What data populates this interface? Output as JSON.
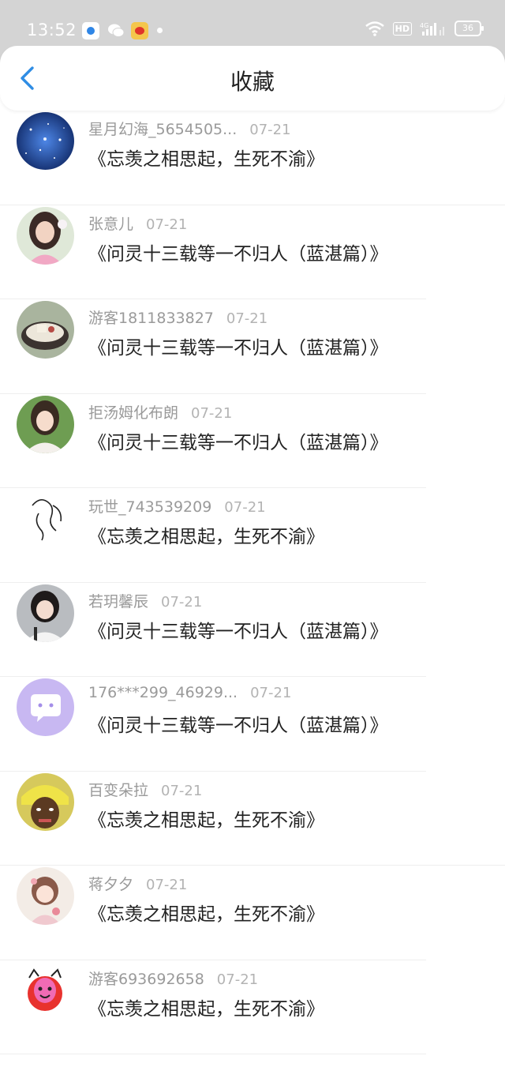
{
  "status_bar": {
    "time": "13:52",
    "network": "4G",
    "hd_badge": "HD",
    "battery": "36"
  },
  "header": {
    "title": "收藏",
    "back_icon": "chevron-left-icon",
    "accent": "#2f8de4"
  },
  "favorites": [
    {
      "user": "星月幻海_5654505...",
      "date": "07-21",
      "title": "《忘羡之相思起，生死不渝》",
      "avatar": "starry-sky"
    },
    {
      "user": "张意儿",
      "date": "07-21",
      "title": "《问灵十三载等一不归人（蓝湛篇）》",
      "avatar": "girl-portrait"
    },
    {
      "user": "游客1811833827",
      "date": "07-21",
      "title": "《问灵十三载等一不归人（蓝湛篇）》",
      "avatar": "dessert-bowl"
    },
    {
      "user": "拒汤姆化布朗",
      "date": "07-21",
      "title": "《问灵十三载等一不归人（蓝湛篇）》",
      "avatar": "girl-outdoor"
    },
    {
      "user": "玩世_743539209",
      "date": "07-21",
      "title": "《忘羡之相思起，生死不渝》",
      "avatar": "line-sketch"
    },
    {
      "user": "若玥馨辰",
      "date": "07-21",
      "title": "《问灵十三载等一不归人（蓝湛篇）》",
      "avatar": "girl-school"
    },
    {
      "user": "176***299_46929...",
      "date": "07-21",
      "title": "《问灵十三载等一不归人（蓝湛篇）》",
      "avatar": "default-chat"
    },
    {
      "user": "百变朵拉",
      "date": "07-21",
      "title": "《忘羡之相思起，生死不渝》",
      "avatar": "meme-face"
    },
    {
      "user": "蒋夕夕",
      "date": "07-21",
      "title": "《忘羡之相思起，生死不渝》",
      "avatar": "anime-girl"
    },
    {
      "user": "游客693692658",
      "date": "07-21",
      "title": "《忘羡之相思起，生死不渝》",
      "avatar": "cartoon-character"
    }
  ]
}
